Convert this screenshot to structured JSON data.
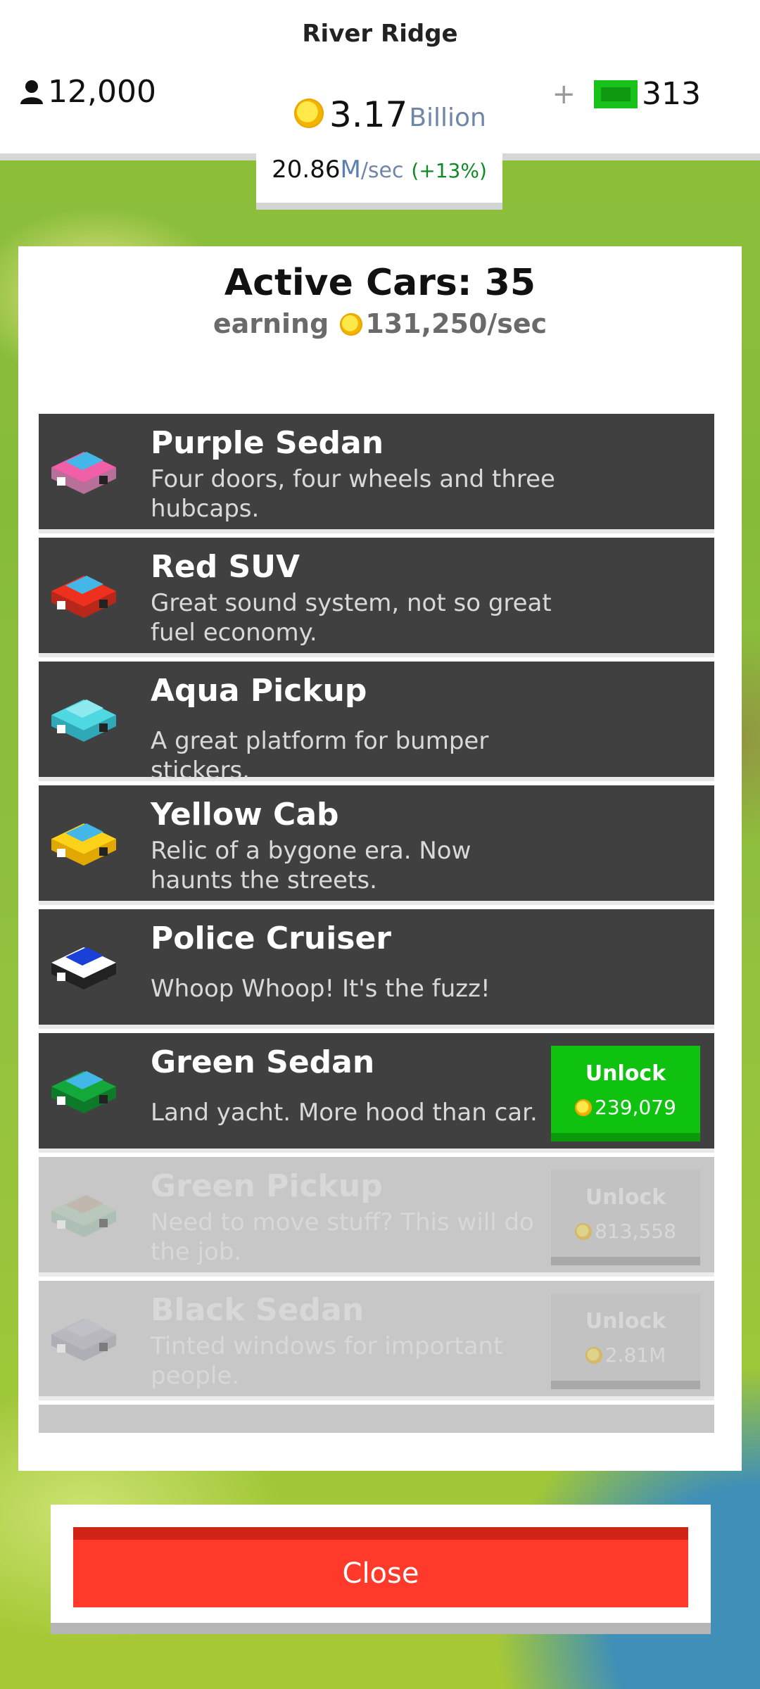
{
  "header": {
    "city_name": "River Ridge",
    "population": "12,000",
    "coins_amount": "3.17",
    "coins_unit": "Billion",
    "cash_plus": "+",
    "cash_amount": "313",
    "rate_value": "20.86",
    "rate_unit": "M",
    "rate_per": "/sec",
    "rate_pct": "(+13%)"
  },
  "panel": {
    "title": "Active Cars: 35",
    "earning_label": "earning",
    "earning_value": "131,250/sec"
  },
  "cars": [
    {
      "name": "Purple Sedan",
      "desc": "Four doors, four wheels and three hubcaps.",
      "icon": "purple-sedan-icon",
      "colors": [
        "#f05fa8",
        "#43b8e8",
        "#b8709a"
      ]
    },
    {
      "name": "Red SUV",
      "desc": "Great sound system, not so great fuel economy.",
      "icon": "red-suv-icon",
      "colors": [
        "#f0301e",
        "#43b8e8",
        "#b8281a"
      ]
    },
    {
      "name": "Aqua Pickup",
      "desc": "A great platform for bumper stickers.",
      "icon": "aqua-pickup-icon",
      "colors": [
        "#4fd8e0",
        "#8feaf0",
        "#2fa8b8"
      ]
    },
    {
      "name": "Yellow Cab",
      "desc": "Relic of a bygone era. Now haunts the streets.",
      "icon": "yellow-cab-icon",
      "colors": [
        "#ffd21a",
        "#43b8e8",
        "#e0a800"
      ]
    },
    {
      "name": "Police Cruiser",
      "desc": "Whoop Whoop! It's the fuzz!",
      "icon": "police-cruiser-icon",
      "colors": [
        "#ffffff",
        "#1a40d8",
        "#222222"
      ]
    },
    {
      "name": "Green Sedan",
      "desc": "Land yacht. More hood than car.",
      "icon": "green-sedan-icon",
      "colors": [
        "#14a83a",
        "#43b8e8",
        "#0c7a28"
      ],
      "unlock_label": "Unlock",
      "price": "239,079"
    },
    {
      "name": "Green Pickup",
      "desc": "Need to move stuff? This will do the job.",
      "icon": "green-pickup-icon",
      "colors": [
        "#a9c8b0",
        "#b8a890",
        "#90b8a0"
      ],
      "unlock_label": "Unlock",
      "price": "813,558"
    },
    {
      "name": "Black Sedan",
      "desc": "Tinted windows for important people.",
      "icon": "black-sedan-icon",
      "colors": [
        "#a8a8b4",
        "#b8b8c8",
        "#9090a0"
      ],
      "unlock_label": "Unlock",
      "price": "2.81M"
    }
  ],
  "close_label": "Close"
}
